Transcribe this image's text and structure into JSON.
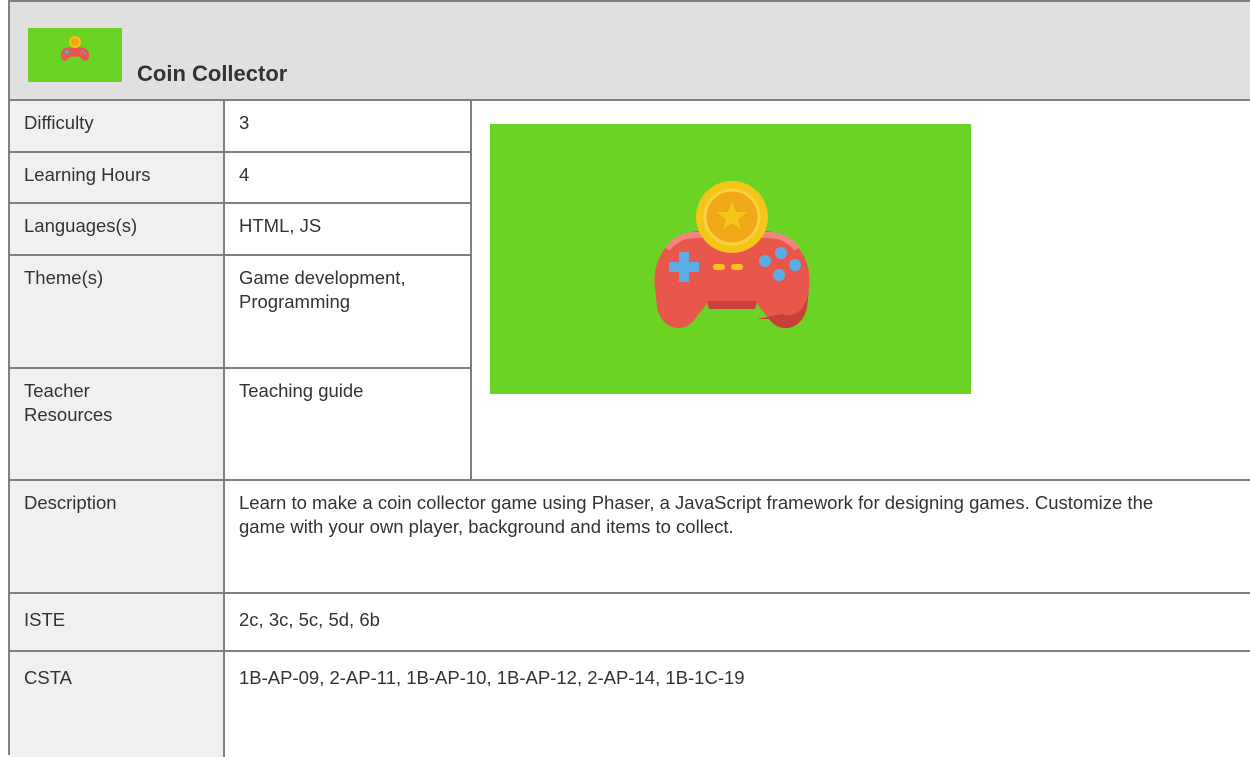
{
  "header": {
    "title": "Coin Collector",
    "icon": "gamepad-coin-icon"
  },
  "rows": [
    {
      "label": "Difficulty",
      "value": "3"
    },
    {
      "label": "Learning Hours",
      "value": "4"
    },
    {
      "label": "Languages(s)",
      "value": "HTML, JS"
    },
    {
      "label": "Theme(s)",
      "value": "Game development, Programming"
    },
    {
      "label": "Teacher Resources",
      "value": "Teaching guide"
    },
    {
      "label": "Description",
      "value": "Learn to make a coin collector game using Phaser, a JavaScript framework for designing games. Customize the game with your own player, background and items to collect."
    },
    {
      "label": "ISTE",
      "value": "2c, 3c, 5c, 5d, 6b"
    },
    {
      "label": "CSTA",
      "value": "1B-AP-09, 2-AP-11, 1B-AP-10, 1B-AP-12, 2-AP-14, 1B-1C-19"
    }
  ],
  "image": {
    "icon": "gamepad-coin-icon",
    "background": "#6bd324"
  },
  "colors": {
    "header_bg": "#e0e0e0",
    "label_bg": "#f0f0f0",
    "border": "#808080",
    "accent_green": "#6bd324"
  }
}
